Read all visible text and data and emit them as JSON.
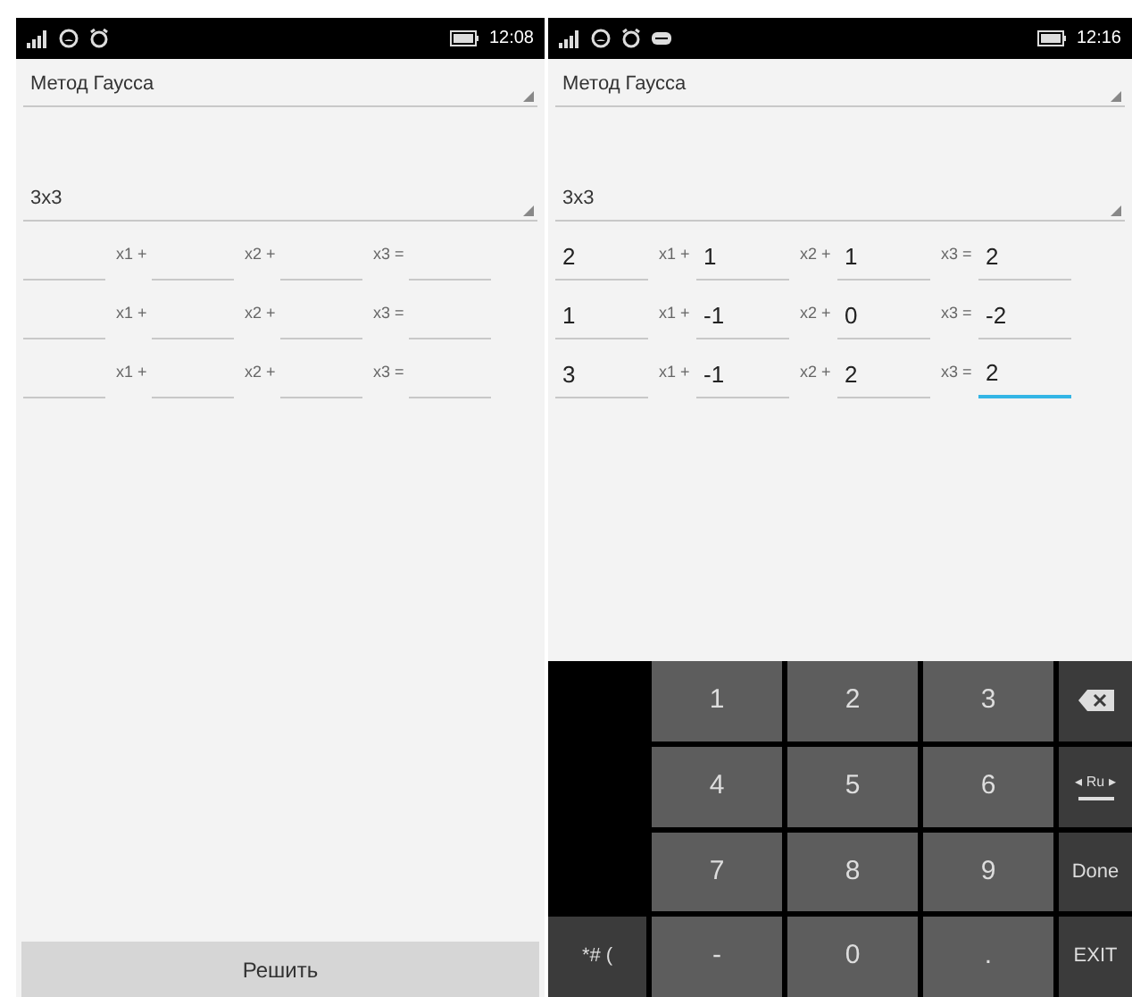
{
  "screens": [
    {
      "status_bar": {
        "time": "12:08"
      },
      "method_dropdown": {
        "value": "Метод Гаусса"
      },
      "size_dropdown": {
        "value": "3x3"
      },
      "equations": [
        {
          "labels": [
            "x1 +",
            "x2 +",
            "x3 ="
          ]
        },
        {
          "labels": [
            "x1 +",
            "x2 +",
            "x3 ="
          ]
        },
        {
          "labels": [
            "x1 +",
            "x2 +",
            "x3 ="
          ]
        }
      ],
      "solve_button": {
        "label": "Решить"
      }
    },
    {
      "status_bar": {
        "time": "12:16",
        "usb": true
      },
      "method_dropdown": {
        "value": "Метод Гаусса"
      },
      "size_dropdown": {
        "value": "3x3"
      },
      "equations": [
        {
          "labels": [
            "x1 +",
            "x2 +",
            "x3 ="
          ],
          "fields": [
            {
              "value": "2",
              "focused": false
            },
            {
              "value": "1",
              "focused": false
            },
            {
              "value": "1",
              "focused": false
            },
            {
              "value": "2",
              "focused": false
            }
          ]
        },
        {
          "labels": [
            "x1 +",
            "x2 +",
            "x3 ="
          ],
          "fields": [
            {
              "value": "1",
              "focused": false
            },
            {
              "value": "-1",
              "focused": false
            },
            {
              "value": "0",
              "focused": false
            },
            {
              "value": "-2",
              "focused": false
            }
          ]
        },
        {
          "labels": [
            "x1 +",
            "x2 +",
            "x3 ="
          ],
          "fields": [
            {
              "value": "3",
              "focused": false
            },
            {
              "value": "-1",
              "focused": false
            },
            {
              "value": "2",
              "focused": false
            },
            {
              "value": "2",
              "focused": true
            }
          ]
        }
      ],
      "keyboard": {
        "rows": [
          [
            {
              "kind": "blank"
            },
            {
              "kind": "digit",
              "label": "1"
            },
            {
              "kind": "digit",
              "label": "2"
            },
            {
              "kind": "digit",
              "label": "3"
            },
            {
              "kind": "backspace"
            }
          ],
          [
            {
              "kind": "blank"
            },
            {
              "kind": "digit",
              "label": "4"
            },
            {
              "kind": "digit",
              "label": "5"
            },
            {
              "kind": "digit",
              "label": "6"
            },
            {
              "kind": "language",
              "label": "◂ Ru ▸"
            }
          ],
          [
            {
              "kind": "blank"
            },
            {
              "kind": "digit",
              "label": "7"
            },
            {
              "kind": "digit",
              "label": "8"
            },
            {
              "kind": "digit",
              "label": "9"
            },
            {
              "kind": "function",
              "label": "Done"
            }
          ],
          [
            {
              "kind": "function",
              "label": "*# ("
            },
            {
              "kind": "digit",
              "label": "-"
            },
            {
              "kind": "digit",
              "label": "0"
            },
            {
              "kind": "digit",
              "label": "."
            },
            {
              "kind": "function",
              "label": "EXIT"
            }
          ]
        ]
      }
    }
  ]
}
